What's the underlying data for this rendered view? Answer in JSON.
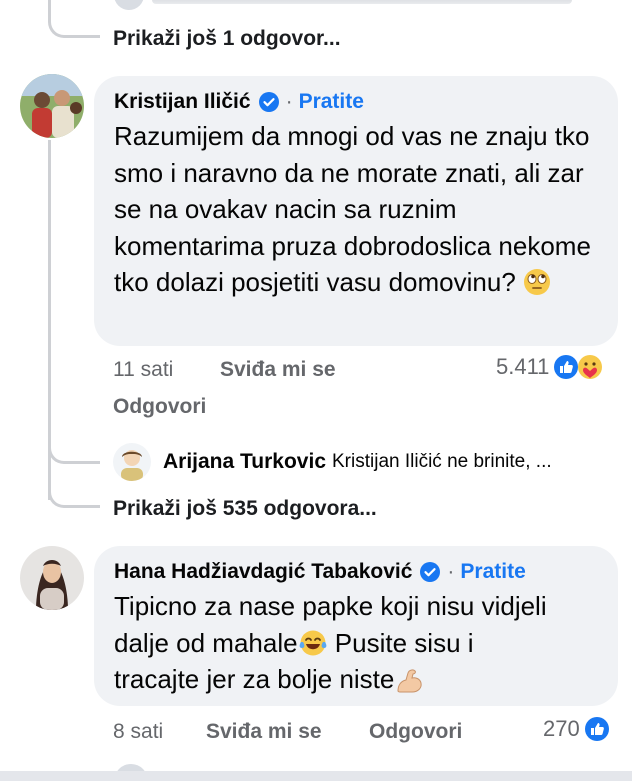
{
  "top": {
    "more_replies_label": "Prikaži još 1 odgovor..."
  },
  "comment1": {
    "author": "Kristijan Iličić",
    "separator": "·",
    "follow_label": "Pratite",
    "text": "Razumijem da mnogi od vas ne znaju tko smo i naravno da ne morate znati, ali zar se na ovakav nacin  sa ruznim komentarima pruza dobrodoslica nekome tko dolazi posjetiti vasu domovinu?",
    "time": "11 sati",
    "like_label": "Sviđa mi se",
    "reply_label": "Odgovori",
    "reaction_count": "5.411",
    "reaction_icons": [
      "like-icon",
      "care-icon"
    ]
  },
  "reply_preview": {
    "author": "Arijana Turkovic",
    "text": "Kristijan Iličić ne brinite, ..."
  },
  "more_replies_535": "Prikaži još 535 odgovora...",
  "comment2": {
    "author": "Hana Hadžiavdagić Tabaković",
    "separator": "·",
    "follow_label": "Pratite",
    "text_line1": "Tipicno za nase papke koji nisu vidjeli",
    "text_line2a": "dalje od mahale",
    "text_line2b": " Pusite sisu i",
    "text_line3": "tracajte jer za bolje niste",
    "time": "8 sati",
    "like_label": "Sviđa mi se",
    "reply_label": "Odgovori",
    "reaction_count": "270",
    "reaction_icons": [
      "like-icon"
    ]
  },
  "colors": {
    "accent": "#1877f2",
    "bubble": "#f0f2f5",
    "muted": "#65676b",
    "thread_line": "#ced0d4"
  }
}
